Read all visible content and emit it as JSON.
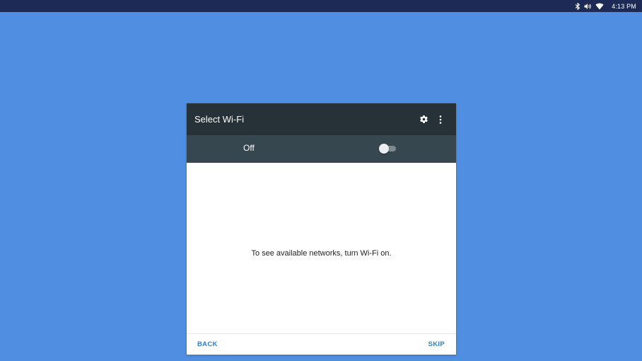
{
  "status_bar": {
    "time": "4:13 PM",
    "icons": [
      "bluetooth-icon",
      "volume-icon",
      "wifi-icon"
    ]
  },
  "dialog": {
    "title": "Select Wi-Fi",
    "toolbar_icons": [
      "gear-icon",
      "more-vert-icon"
    ],
    "toggle": {
      "label": "Off",
      "checked": false
    },
    "empty_message": "To see available networks, turn Wi-Fi on.",
    "back_label": "BACK",
    "skip_label": "SKIP"
  },
  "colors": {
    "background": "#4f8ee0",
    "status_bar": "#1d2a55",
    "toolbar": "#263238",
    "toggle_row": "#37474f",
    "accent": "#2d7fd3"
  }
}
